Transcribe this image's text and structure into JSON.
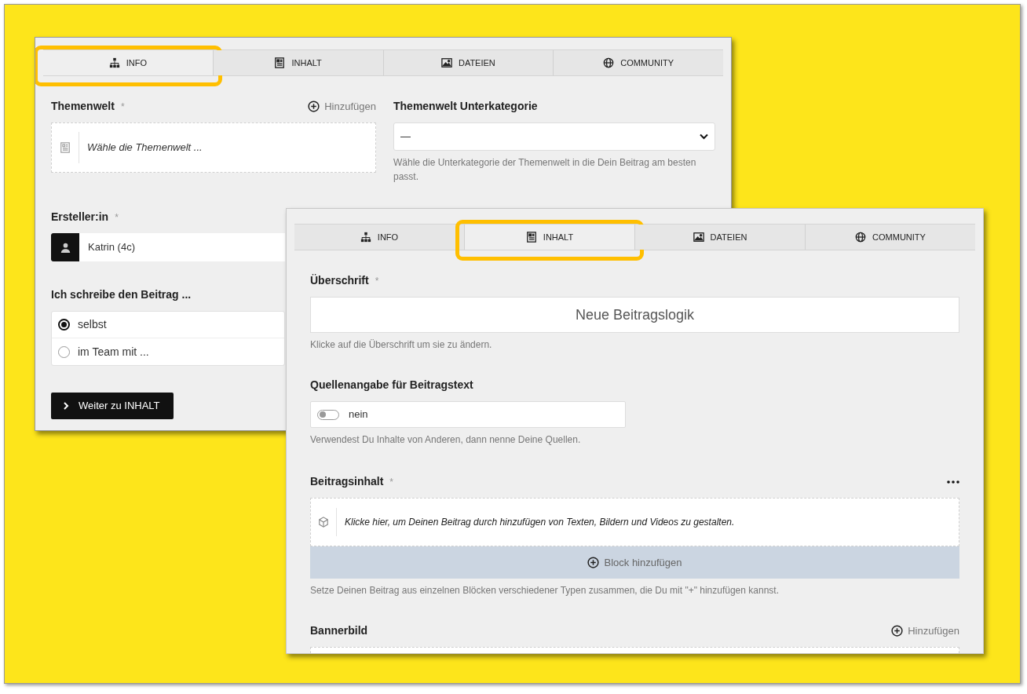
{
  "windows": [
    {
      "tabs": [
        {
          "label": "INFO",
          "selected": true
        },
        {
          "label": "INHALT",
          "selected": false
        },
        {
          "label": "DATEIEN",
          "selected": false
        },
        {
          "label": "COMMUNITY",
          "selected": false
        }
      ],
      "themenwelt": {
        "label": "Themenwelt",
        "asterisk": "*",
        "add": "Hinzufügen",
        "placeholder": "Wähle die Themenwelt ..."
      },
      "unterkategorie": {
        "label": "Themenwelt Unterkategorie",
        "value": "—",
        "help": "Wähle die Unterkategorie der Themenwelt in die Dein Beitrag am besten passt."
      },
      "ersteller": {
        "label": "Ersteller:in",
        "asterisk": "*",
        "value": "Katrin (4c)"
      },
      "autorschaft": {
        "label": "Ich schreibe den Beitrag ...",
        "options": [
          {
            "label": "selbst",
            "selected": true
          },
          {
            "label": "im Team mit ...",
            "selected": false
          }
        ]
      },
      "button": "Weiter zu INHALT"
    },
    {
      "tabs": [
        {
          "label": "INFO",
          "selected": false
        },
        {
          "label": "INHALT",
          "selected": true
        },
        {
          "label": "DATEIEN",
          "selected": false
        },
        {
          "label": "COMMUNITY",
          "selected": false
        }
      ],
      "ueberschrift": {
        "label": "Überschrift",
        "asterisk": "*",
        "value": "Neue Beitragslogik",
        "help": "Klicke auf die Überschrift um sie zu ändern."
      },
      "quellen": {
        "label": "Quellenangabe für Beitragstext",
        "on": false,
        "value": "nein",
        "help": "Verwendest Du Inhalte von Anderen, dann nenne Deine Quellen."
      },
      "beitragsinhalt": {
        "label": "Beitragsinhalt",
        "asterisk": "*",
        "placeholder": "Klicke hier, um Deinen Beitrag durch hinzufügen von Texten, Bildern und Videos zu gestalten.",
        "add_block": "Block hinzufügen",
        "help": "Setze Deinen Beitrag aus einzelnen Blöcken verschiedener Typen zusammen, die Du mit \"+\" hinzufügen kannst."
      },
      "bannerbild": {
        "label": "Bannerbild",
        "add": "Hinzufügen"
      }
    }
  ]
}
